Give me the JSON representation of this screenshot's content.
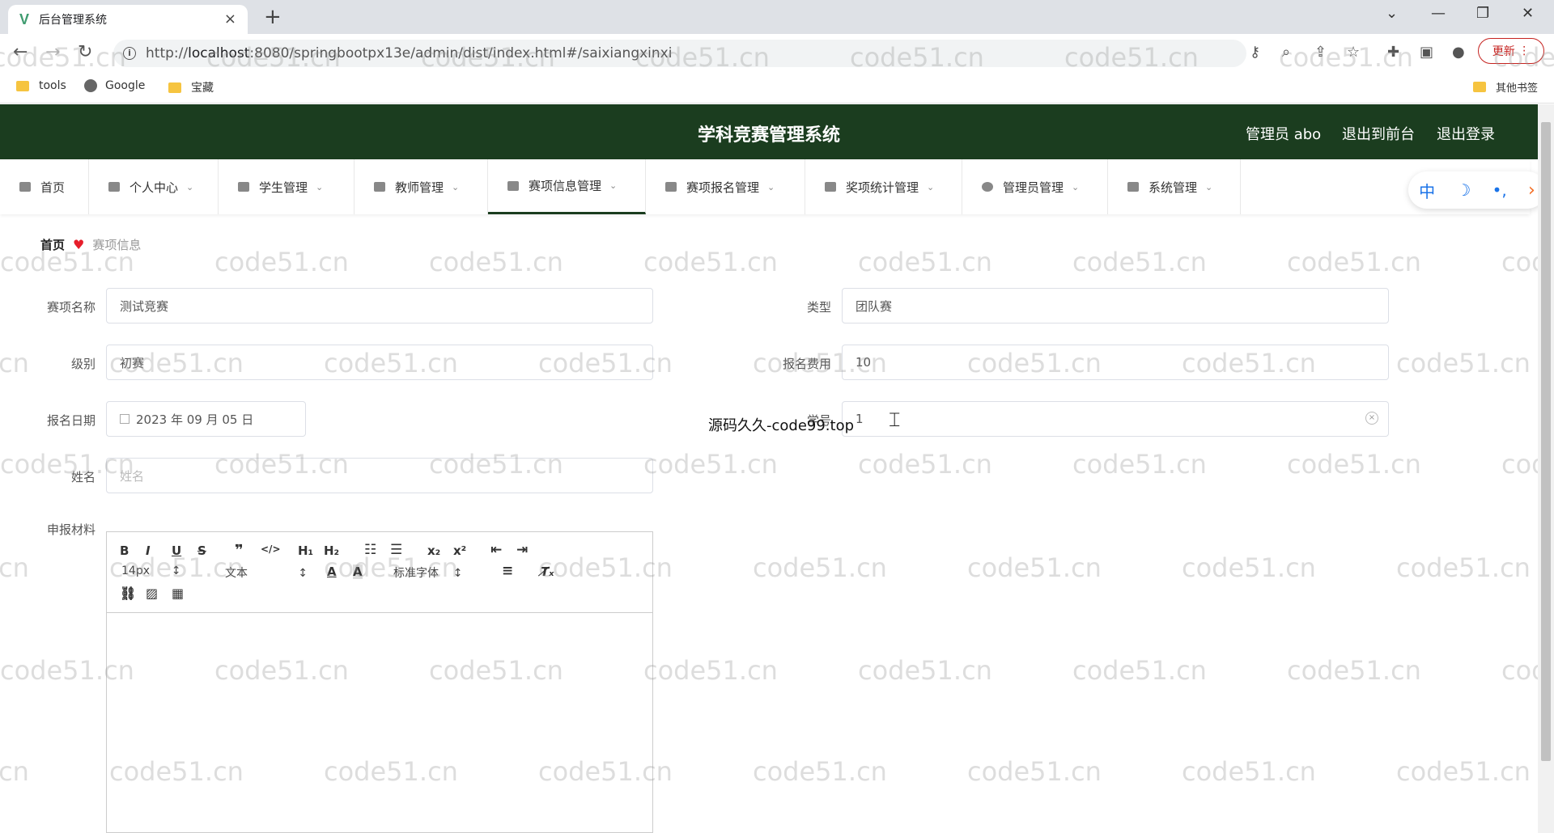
{
  "browser": {
    "tab_title": "后台管理系统",
    "tab_close": "×",
    "new_tab": "+",
    "url_prefix": "http://",
    "url_host": "localhost",
    "url_rest": ":8080/springbootpx13e/admin/dist/index.html#/saixiangxinxi",
    "update_label": "更新",
    "bookmarks": [
      "tools",
      "Google",
      "宝藏"
    ],
    "other_bookmarks": "其他书签"
  },
  "header": {
    "title": "学科竞赛管理系统",
    "user": "管理员 abo",
    "to_front": "退出到前台",
    "logout": "退出登录"
  },
  "menu": [
    {
      "label": "首页"
    },
    {
      "label": "个人中心"
    },
    {
      "label": "学生管理"
    },
    {
      "label": "教师管理"
    },
    {
      "label": "赛项信息管理"
    },
    {
      "label": "赛项报名管理"
    },
    {
      "label": "奖项统计管理"
    },
    {
      "label": "管理员管理"
    },
    {
      "label": "系统管理"
    }
  ],
  "lang_widget": {
    "zh": "中",
    "moon": "☽",
    "dots": "•,",
    "arrow": "›"
  },
  "breadcrumb": {
    "home": "首页",
    "current": "赛项信息"
  },
  "form": {
    "name_label": "赛项名称",
    "name_value": "测试竞赛",
    "type_label": "类型",
    "type_value": "团队赛",
    "level_label": "级别",
    "level_value": "初赛",
    "fee_label": "报名费用",
    "fee_value": "10",
    "date_label": "报名日期",
    "date_value": "2023 年 09 月 05 日",
    "xuehao_label": "学号",
    "xuehao_value": "1",
    "xingming_label": "姓名",
    "xingming_placeholder": "姓名",
    "material_label": "申报材料"
  },
  "editor": {
    "font_size": "14px",
    "text_style": "文本",
    "font_family": "标准字体"
  },
  "overlay_text": "源码久久-code99.top",
  "watermark": "code51.cn"
}
